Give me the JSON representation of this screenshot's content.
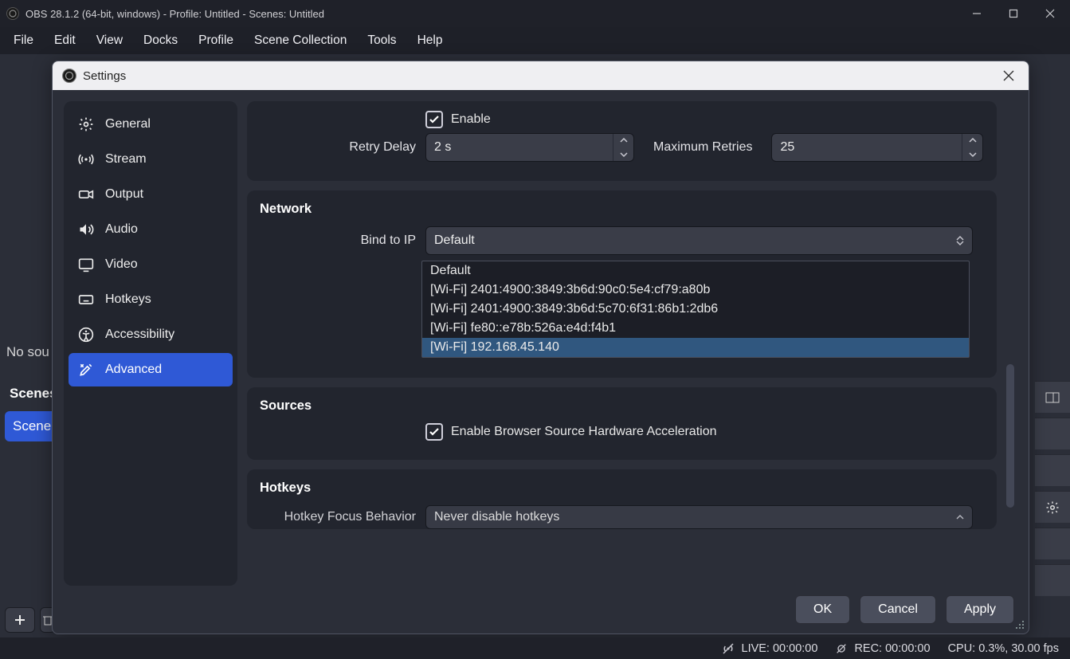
{
  "titlebar": {
    "title": "OBS 28.1.2 (64-bit, windows) - Profile: Untitled - Scenes: Untitled"
  },
  "menubar": {
    "items": [
      "File",
      "Edit",
      "View",
      "Docks",
      "Profile",
      "Scene Collection",
      "Tools",
      "Help"
    ]
  },
  "backdrop": {
    "no_sources": "No sou",
    "scenes_header": "Scenes",
    "scene_selected": "Scene"
  },
  "dialog": {
    "title": "Settings",
    "sidebar": {
      "items": [
        {
          "label": "General"
        },
        {
          "label": "Stream"
        },
        {
          "label": "Output"
        },
        {
          "label": "Audio"
        },
        {
          "label": "Video"
        },
        {
          "label": "Hotkeys"
        },
        {
          "label": "Accessibility"
        },
        {
          "label": "Advanced"
        }
      ],
      "active_index": 7
    },
    "retry": {
      "enable_label": "Enable",
      "enable_checked": true,
      "retry_delay_label": "Retry Delay",
      "retry_delay_value": "2 s",
      "max_retries_label": "Maximum Retries",
      "max_retries_value": "25"
    },
    "network": {
      "section_title": "Network",
      "bind_label": "Bind to IP",
      "bind_value": "Default",
      "options": [
        "Default",
        "[Wi-Fi] 2401:4900:3849:3b6d:90c0:5e4:cf79:a80b",
        "[Wi-Fi] 2401:4900:3849:3b6d:5c70:6f31:86b1:2db6",
        "[Wi-Fi] fe80::e78b:526a:e4d:f4b1",
        "[Wi-Fi] 192.168.45.140"
      ],
      "highlight_index": 4
    },
    "sources": {
      "section_title": "Sources",
      "browser_hw_label": "Enable Browser Source Hardware Acceleration",
      "browser_hw_checked": true
    },
    "hotkeys": {
      "section_title": "Hotkeys",
      "focus_label": "Hotkey Focus Behavior",
      "focus_value": "Never disable hotkeys"
    },
    "footer": {
      "ok": "OK",
      "cancel": "Cancel",
      "apply": "Apply"
    }
  },
  "statusbar": {
    "live": "LIVE: 00:00:00",
    "rec": "REC: 00:00:00",
    "cpu": "CPU: 0.3%, 30.00 fps"
  }
}
